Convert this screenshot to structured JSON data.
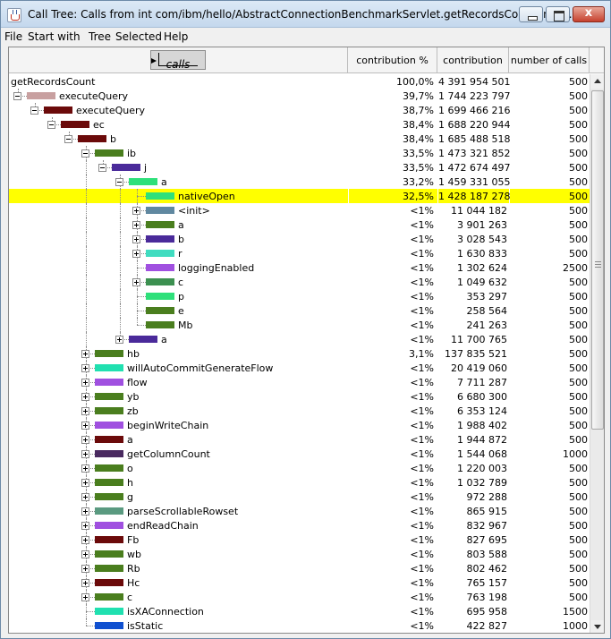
{
  "window": {
    "title": "Call Tree: Calls from int com/ibm/hello/AbstractConnectionBenchmarkServlet.getRecordsCount(int):...",
    "close_glyph": "x"
  },
  "menu": [
    "File",
    "Start with",
    "Tree",
    "Selected",
    "Help"
  ],
  "columns": {
    "calls": "calls",
    "contribution_pct": "contribution %",
    "contribution": "contribution",
    "number_of_calls": "number of calls"
  },
  "rows": [
    {
      "depth": 0,
      "label": "getRecordsCount",
      "pct": "100,0%",
      "contrib": "4 391 954 501",
      "calls": "500",
      "color": null,
      "toggle": null
    },
    {
      "depth": 1,
      "label": "executeQuery",
      "pct": "39,7%",
      "contrib": "1 744 223 797",
      "calls": "500",
      "color": "#c8a0a0",
      "toggle": "minus"
    },
    {
      "depth": 2,
      "label": "executeQuery",
      "pct": "38,7%",
      "contrib": "1 699 466 216",
      "calls": "500",
      "color": "#6b0a0a",
      "toggle": "minus"
    },
    {
      "depth": 3,
      "label": "ec",
      "pct": "38,4%",
      "contrib": "1 688 220 944",
      "calls": "500",
      "color": "#6b0a0a",
      "toggle": "minus"
    },
    {
      "depth": 4,
      "label": "b",
      "pct": "38,4%",
      "contrib": "1 685 488 518",
      "calls": "500",
      "color": "#6b0a0a",
      "toggle": "minus"
    },
    {
      "depth": 5,
      "label": "ib",
      "pct": "33,5%",
      "contrib": "1 473 321 852",
      "calls": "500",
      "color": "#4a7e1e",
      "toggle": "minus"
    },
    {
      "depth": 6,
      "label": "j",
      "pct": "33,5%",
      "contrib": "1 472 674 497",
      "calls": "500",
      "color": "#4a2a9a",
      "toggle": "minus"
    },
    {
      "depth": 7,
      "label": "a",
      "pct": "33,2%",
      "contrib": "1 459 331 055",
      "calls": "500",
      "color": "#2ee07a",
      "toggle": "minus"
    },
    {
      "depth": 8,
      "label": "nativeOpen",
      "pct": "32,5%",
      "contrib": "1 428 187 278",
      "calls": "500",
      "color": "#2ee07a",
      "toggle": null,
      "highlight": true
    },
    {
      "depth": 8,
      "label": "<init>",
      "pct": "<1%",
      "contrib": "11 044 182",
      "calls": "500",
      "color": "#6088a0",
      "toggle": "plus"
    },
    {
      "depth": 8,
      "label": "a",
      "pct": "<1%",
      "contrib": "3 901 263",
      "calls": "500",
      "color": "#4a7e1e",
      "toggle": "plus"
    },
    {
      "depth": 8,
      "label": "b",
      "pct": "<1%",
      "contrib": "3 028 543",
      "calls": "500",
      "color": "#4a2a9a",
      "toggle": "plus"
    },
    {
      "depth": 8,
      "label": "r",
      "pct": "<1%",
      "contrib": "1 630 833",
      "calls": "500",
      "color": "#40dcc0",
      "toggle": "plus"
    },
    {
      "depth": 8,
      "label": "loggingEnabled",
      "pct": "<1%",
      "contrib": "1 302 624",
      "calls": "2500",
      "color": "#a050e0",
      "toggle": null
    },
    {
      "depth": 8,
      "label": "c",
      "pct": "<1%",
      "contrib": "1 049 632",
      "calls": "500",
      "color": "#3c9050",
      "toggle": "plus"
    },
    {
      "depth": 8,
      "label": "p",
      "pct": "<1%",
      "contrib": "353 297",
      "calls": "500",
      "color": "#2ee07a",
      "toggle": null
    },
    {
      "depth": 8,
      "label": "e",
      "pct": "<1%",
      "contrib": "258 564",
      "calls": "500",
      "color": "#4a7e1e",
      "toggle": null
    },
    {
      "depth": 8,
      "label": "Mb",
      "pct": "<1%",
      "contrib": "241 263",
      "calls": "500",
      "color": "#4a7e1e",
      "toggle": null
    },
    {
      "depth": 7,
      "label": "a",
      "pct": "<1%",
      "contrib": "11 700 765",
      "calls": "500",
      "color": "#4a2a9a",
      "toggle": "plus"
    },
    {
      "depth": 5,
      "label": "hb",
      "pct": "3,1%",
      "contrib": "137 835 521",
      "calls": "500",
      "color": "#4a7e1e",
      "toggle": "plus"
    },
    {
      "depth": 5,
      "label": "willAutoCommitGenerateFlow",
      "pct": "<1%",
      "contrib": "20 419 060",
      "calls": "500",
      "color": "#20e0b0",
      "toggle": "plus"
    },
    {
      "depth": 5,
      "label": "flow",
      "pct": "<1%",
      "contrib": "7 711 287",
      "calls": "500",
      "color": "#a050e0",
      "toggle": "plus"
    },
    {
      "depth": 5,
      "label": "yb",
      "pct": "<1%",
      "contrib": "6 680 300",
      "calls": "500",
      "color": "#4a7e1e",
      "toggle": "plus"
    },
    {
      "depth": 5,
      "label": "zb",
      "pct": "<1%",
      "contrib": "6 353 124",
      "calls": "500",
      "color": "#4a7e1e",
      "toggle": "plus"
    },
    {
      "depth": 5,
      "label": "beginWriteChain",
      "pct": "<1%",
      "contrib": "1 988 402",
      "calls": "500",
      "color": "#a050e0",
      "toggle": "plus"
    },
    {
      "depth": 5,
      "label": "a",
      "pct": "<1%",
      "contrib": "1 944 872",
      "calls": "500",
      "color": "#6b0a0a",
      "toggle": "plus"
    },
    {
      "depth": 5,
      "label": "getColumnCount",
      "pct": "<1%",
      "contrib": "1 544 068",
      "calls": "1000",
      "color": "#4a2a60",
      "toggle": "plus"
    },
    {
      "depth": 5,
      "label": "o",
      "pct": "<1%",
      "contrib": "1 220 003",
      "calls": "500",
      "color": "#4a7e1e",
      "toggle": "plus"
    },
    {
      "depth": 5,
      "label": "h",
      "pct": "<1%",
      "contrib": "1 032 789",
      "calls": "500",
      "color": "#4a7e1e",
      "toggle": "plus"
    },
    {
      "depth": 5,
      "label": "g",
      "pct": "<1%",
      "contrib": "972 288",
      "calls": "500",
      "color": "#4a7e1e",
      "toggle": "plus"
    },
    {
      "depth": 5,
      "label": "parseScrollableRowset",
      "pct": "<1%",
      "contrib": "865 915",
      "calls": "500",
      "color": "#5a9a80",
      "toggle": "plus"
    },
    {
      "depth": 5,
      "label": "endReadChain",
      "pct": "<1%",
      "contrib": "832 967",
      "calls": "500",
      "color": "#a050e0",
      "toggle": "plus"
    },
    {
      "depth": 5,
      "label": "Fb",
      "pct": "<1%",
      "contrib": "827 695",
      "calls": "500",
      "color": "#6b0a0a",
      "toggle": "plus"
    },
    {
      "depth": 5,
      "label": "wb",
      "pct": "<1%",
      "contrib": "803 588",
      "calls": "500",
      "color": "#4a7e1e",
      "toggle": "plus"
    },
    {
      "depth": 5,
      "label": "Rb",
      "pct": "<1%",
      "contrib": "802 462",
      "calls": "500",
      "color": "#4a7e1e",
      "toggle": "plus"
    },
    {
      "depth": 5,
      "label": "Hc",
      "pct": "<1%",
      "contrib": "765 157",
      "calls": "500",
      "color": "#6b0a0a",
      "toggle": "plus"
    },
    {
      "depth": 5,
      "label": "c",
      "pct": "<1%",
      "contrib": "763 198",
      "calls": "500",
      "color": "#4a7e1e",
      "toggle": "plus"
    },
    {
      "depth": 5,
      "label": "isXAConnection",
      "pct": "<1%",
      "contrib": "695 958",
      "calls": "1500",
      "color": "#20e0b0",
      "toggle": null
    },
    {
      "depth": 5,
      "label": "isStatic",
      "pct": "<1%",
      "contrib": "422 827",
      "calls": "1000",
      "color": "#1050d0",
      "toggle": null
    }
  ],
  "scrollbar": {
    "position": 0.0,
    "visible_fraction": 0.64
  }
}
